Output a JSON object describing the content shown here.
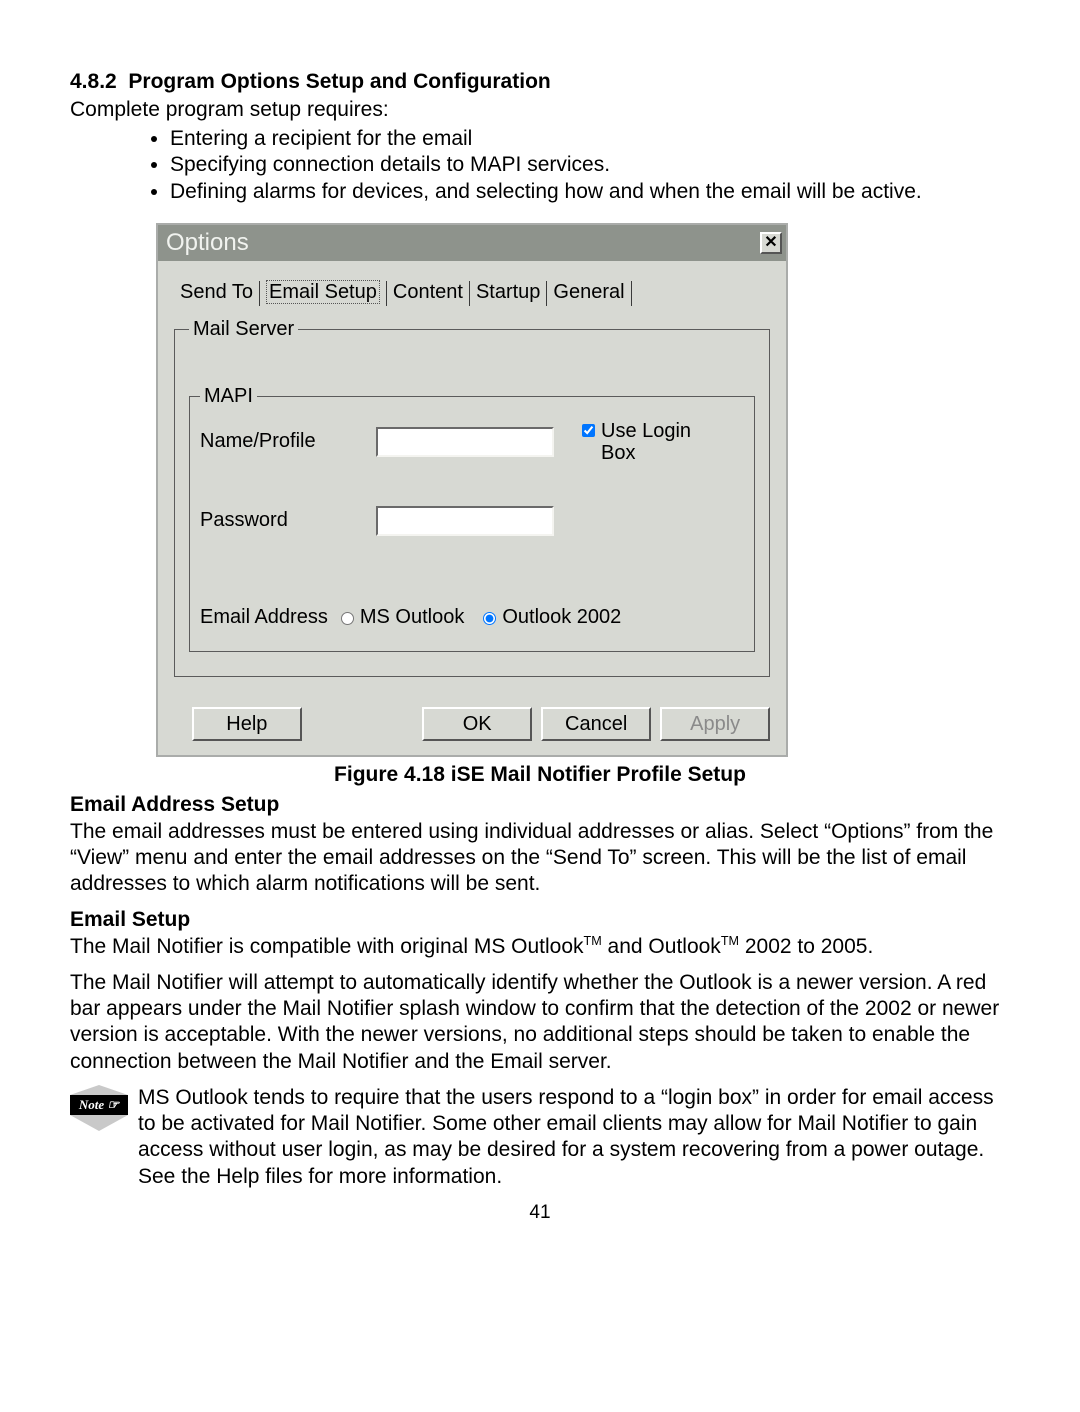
{
  "section_number": "4.8.2",
  "section_title": "Program Options Setup and Configuration",
  "intro": "Complete program setup requires:",
  "bullets": [
    "Entering a recipient for the email",
    "Specifying connection details to MAPI services.",
    "Defining alarms for devices, and selecting how and when the email will be active."
  ],
  "dialog": {
    "title": "Options",
    "close_glyph": "✕",
    "tabs": [
      "Send To",
      "Email Setup",
      "Content",
      "Startup",
      "General"
    ],
    "active_tab_index": 1,
    "group_mail_server": "Mail Server",
    "group_mapi": "MAPI",
    "label_name_profile": "Name/Profile",
    "name_profile_value": "",
    "checkbox_use_login": "Use Login Box",
    "use_login_checked": true,
    "label_password": "Password",
    "password_value": "",
    "label_email_address": "Email Address",
    "radio_options": [
      "MS Outlook",
      "Outlook 2002"
    ],
    "radio_selected_index": 1,
    "buttons": {
      "help": "Help",
      "ok": "OK",
      "cancel": "Cancel",
      "apply": "Apply"
    }
  },
  "figure_caption": "Figure 4.18  iSE Mail Notifier Profile Setup",
  "email_address_setup_heading": "Email Address Setup",
  "email_address_setup_body": "The email addresses must be entered using individual addresses or alias. Select “Options” from the “View” menu and enter the email addresses on the “Send To” screen. This will be the list of email addresses to which alarm notifications will be sent.",
  "email_setup_heading": "Email Setup",
  "email_setup_p1_pre": "The Mail Notifier is compatible with original MS Outlook",
  "email_setup_p1_mid": " and Outlook",
  "email_setup_p1_post": " 2002 to 2005.",
  "email_setup_p2": "The Mail Notifier will attempt to automatically identify whether the Outlook is a newer version.  A red bar appears under the Mail Notifier splash window to confirm that the detection of the 2002 or newer version is acceptable.  With the newer versions, no additional steps should be taken to enable the connection between the Mail Notifier and the Email server.",
  "note_label": "Note ☞",
  "note_body": "MS Outlook tends to require that the users respond to a “login box” in order for email access to be activated for Mail Notifier.  Some other email clients may allow for Mail Notifier to gain access without user login, as may be desired for a system recovering from a power outage.  See the Help files for more information.",
  "page_number": "41",
  "tm": "TM"
}
